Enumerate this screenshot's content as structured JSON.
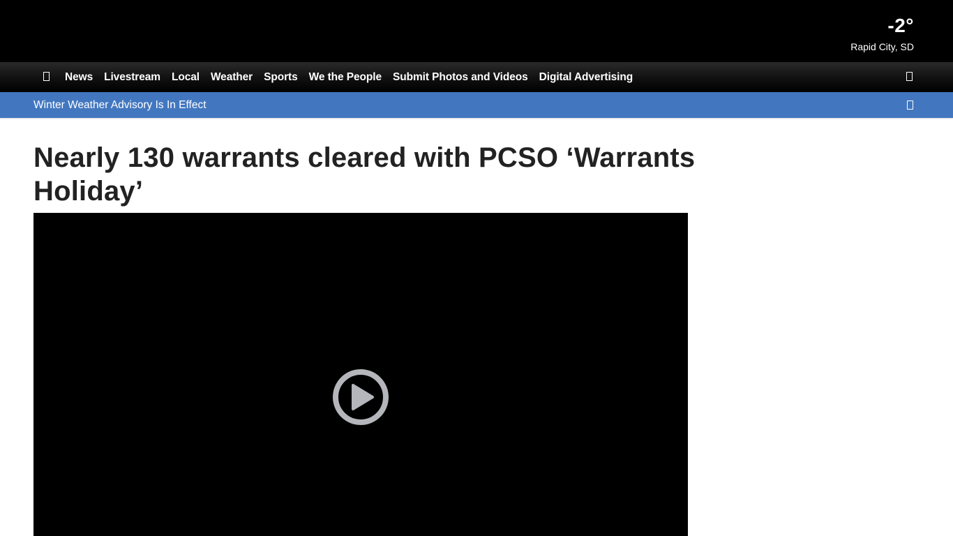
{
  "weather": {
    "temperature": "-2°",
    "location": "Rapid City, SD"
  },
  "nav": {
    "menu_icon": "hamburger-menu-icon",
    "items": [
      {
        "label": "News"
      },
      {
        "label": "Livestream"
      },
      {
        "label": "Local"
      },
      {
        "label": "Weather"
      },
      {
        "label": "Sports"
      },
      {
        "label": "We the People"
      },
      {
        "label": "Submit Photos and Videos"
      },
      {
        "label": "Digital Advertising"
      }
    ],
    "search_icon": "search-icon"
  },
  "alert": {
    "text": "Winter Weather Advisory Is In Effect",
    "close_icon": "close-icon",
    "color": "#4277c0"
  },
  "article": {
    "headline": "Nearly 130 warrants cleared with PCSO ‘Warrants Holiday’"
  },
  "video": {
    "play_icon": "play-icon"
  },
  "colors": {
    "header_bg": "#000000",
    "alert_bg": "#4277c0",
    "headline_text": "#222222",
    "play_button": "#b4b6bb"
  }
}
